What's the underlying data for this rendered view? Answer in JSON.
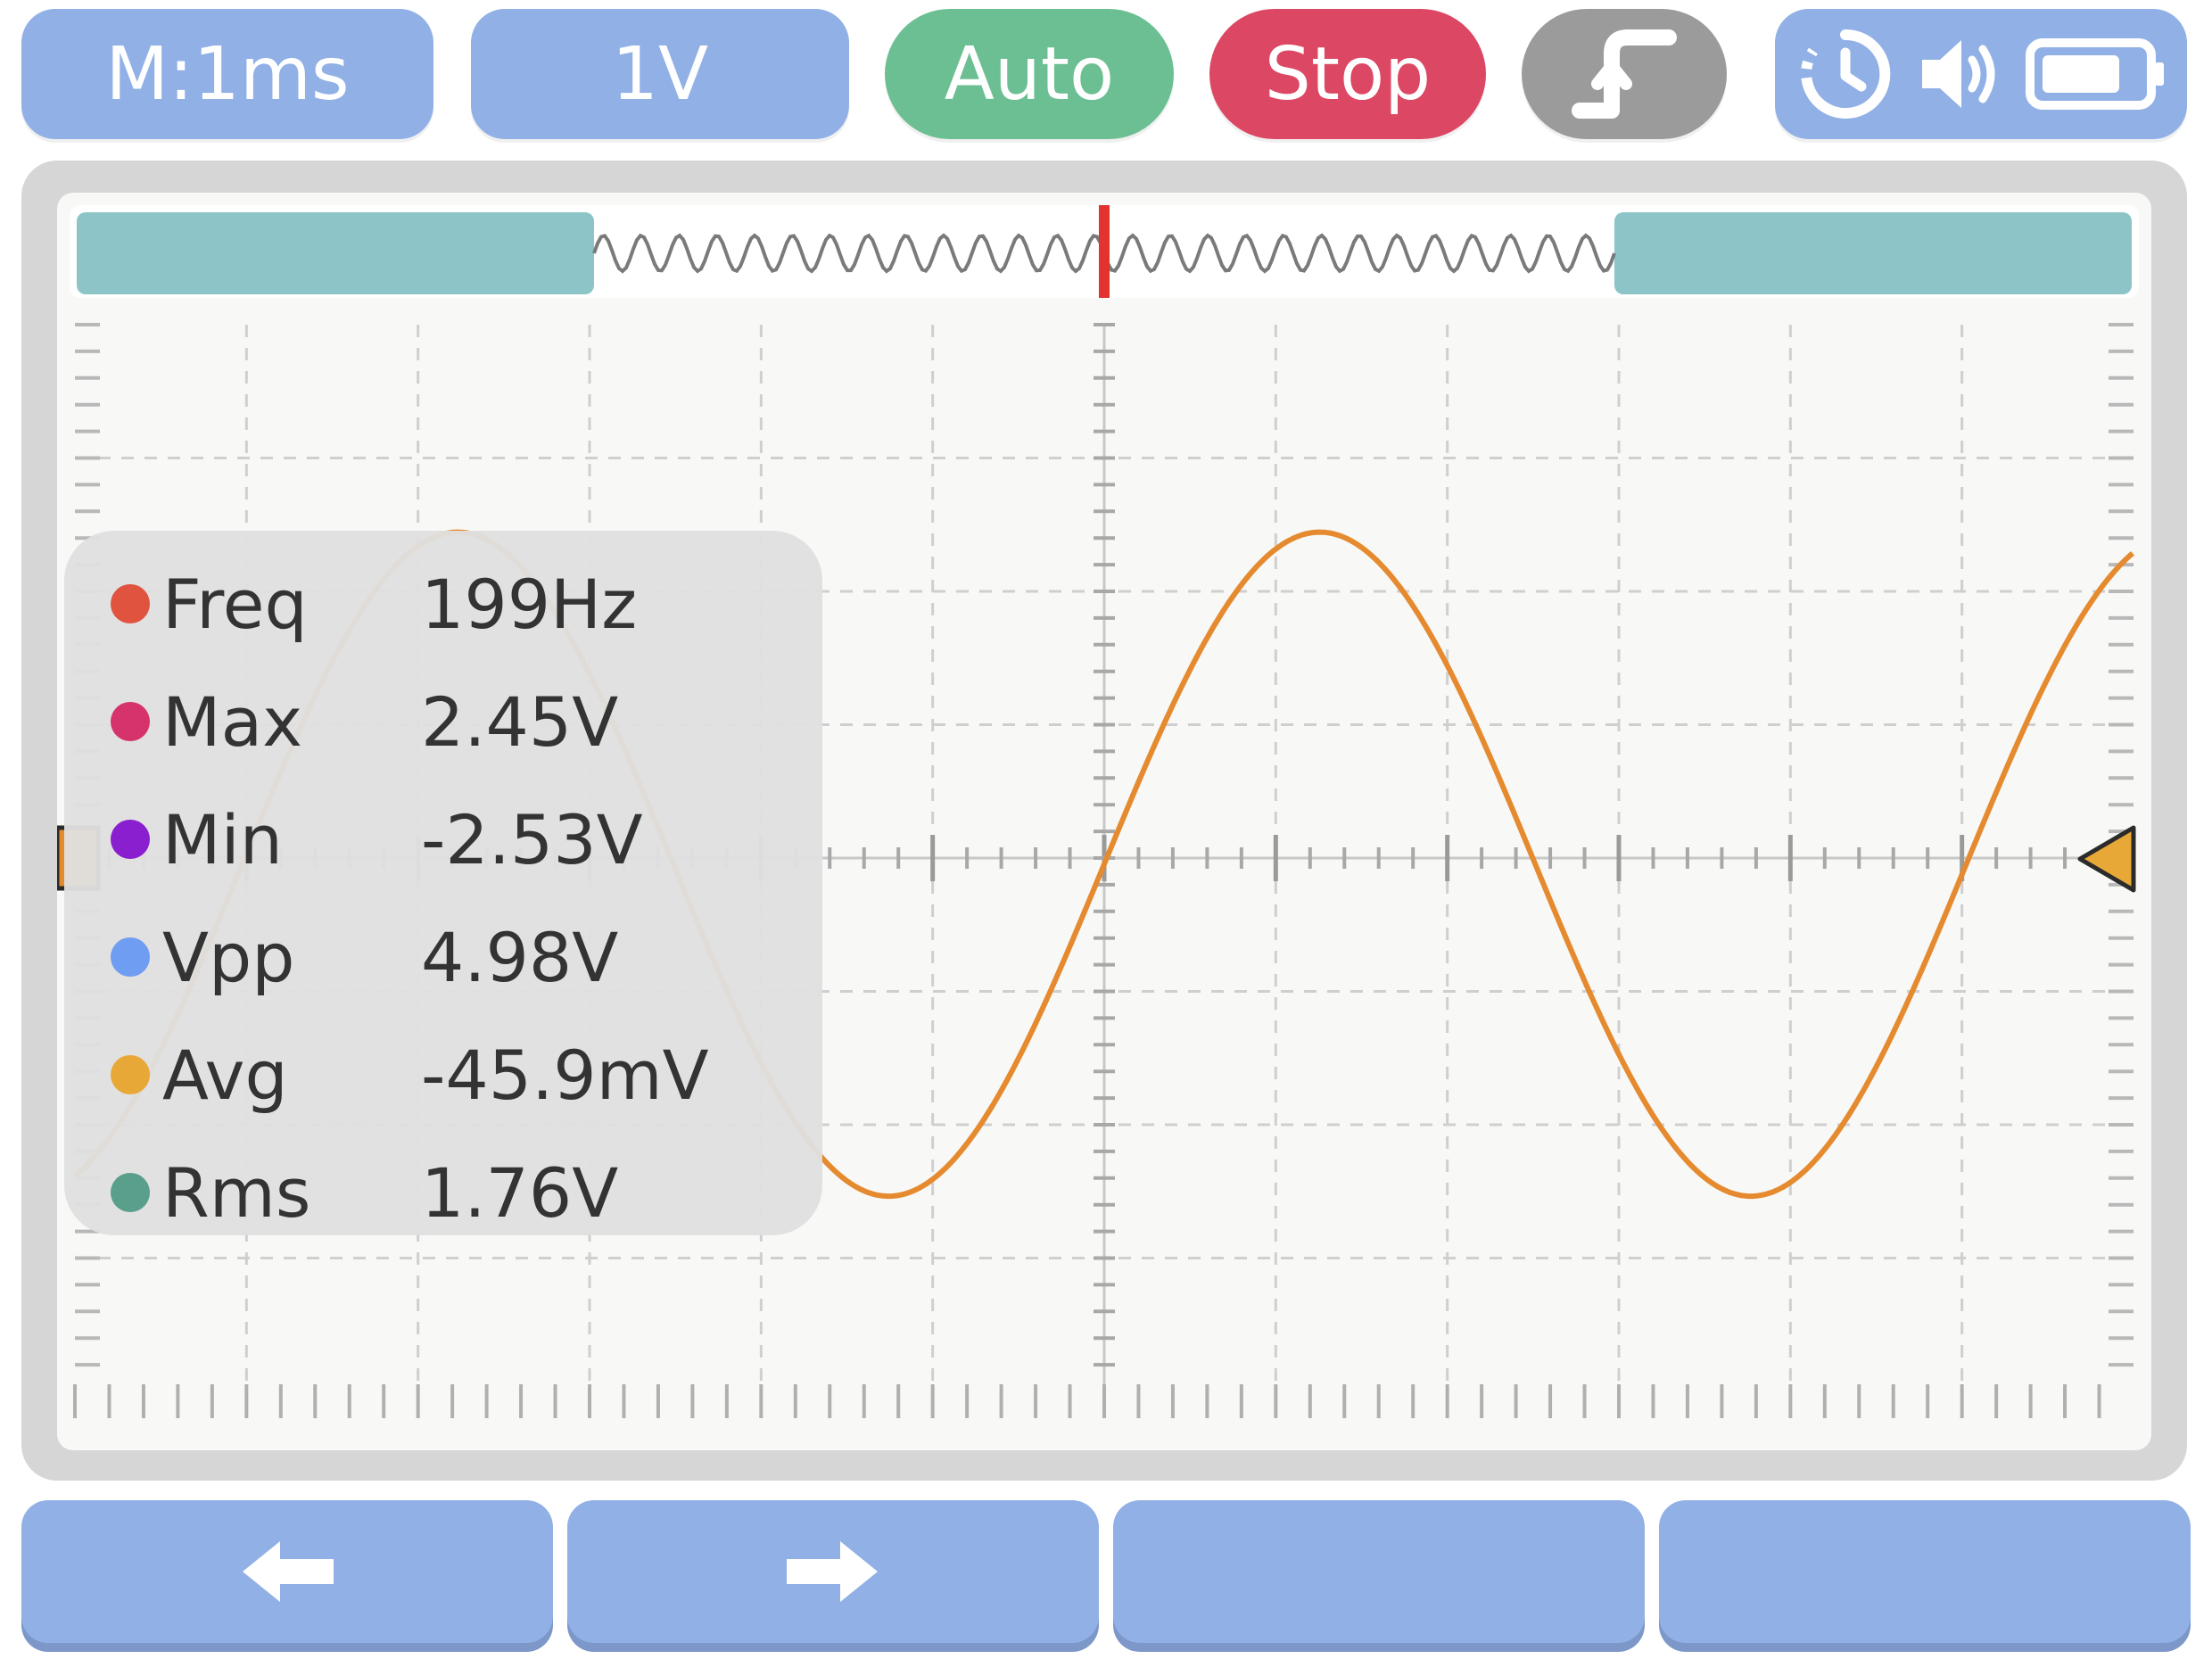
{
  "toolbar": {
    "timebase": "M:1ms",
    "volts_per_div": "1V",
    "mode": "Auto",
    "run_stop": "Stop",
    "colors": {
      "button_blue": "#91b0e6",
      "auto_green": "#6cbf92",
      "stop_red": "#dc4764",
      "trigger_grey": "#9b9b9b"
    },
    "trigger_edge_icon": "rising-edge-icon",
    "status_icons": [
      "history-icon",
      "speaker-icon",
      "battery-icon"
    ]
  },
  "scope": {
    "trace_color": "#e58a2e",
    "timeline_color": "#8cc4c7",
    "trigger_marker_color": "#e3332f",
    "channel_marker_color": "#e58a2e",
    "trigger_level_marker_color": "#e8a838"
  },
  "chart_data": {
    "type": "line",
    "signal": "sine",
    "grid": true,
    "divisions": {
      "x": 12,
      "y": 8
    },
    "units": {
      "time_per_div": "1ms",
      "volts_per_div": "1V"
    },
    "frequency_hz": 199,
    "amplitude_v": 2.49,
    "offset_v": -0.0459
  },
  "measurements": [
    {
      "label": "Freq",
      "value": "199Hz",
      "color": "#e0533f"
    },
    {
      "label": "Max",
      "value": "2.45V",
      "color": "#d6336c"
    },
    {
      "label": "Min",
      "value": "-2.53V",
      "color": "#8a1fcf"
    },
    {
      "label": "Vpp",
      "value": "4.98V",
      "color": "#6f9df2"
    },
    {
      "label": "Avg",
      "value": "-45.9mV",
      "color": "#e8a838"
    },
    {
      "label": "Rms",
      "value": "1.76V",
      "color": "#5a9e8c"
    }
  ],
  "bottom_bar": {
    "icons": [
      "arrow-left-icon",
      "arrow-right-icon"
    ]
  }
}
